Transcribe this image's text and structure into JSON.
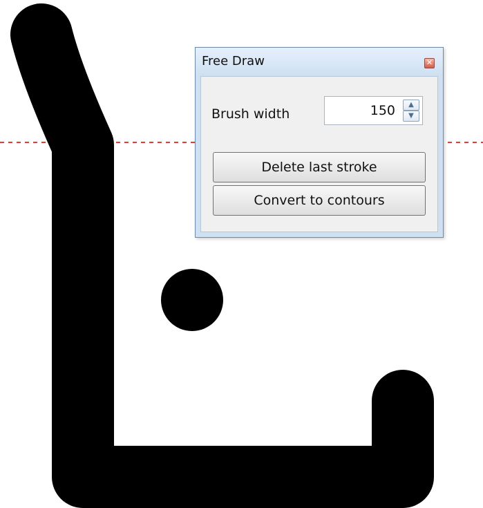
{
  "dialog": {
    "title": "Free Draw",
    "close_icon": "close-icon",
    "brush_width_label": "Brush width",
    "brush_width_value": "150",
    "spinner_up_icon": "chevron-up-icon",
    "spinner_down_icon": "chevron-down-icon",
    "delete_last_stroke_label": "Delete last stroke",
    "convert_to_contours_label": "Convert to contours"
  },
  "canvas": {
    "stroke_color": "#000000",
    "guide_line_color": "#e53935"
  }
}
